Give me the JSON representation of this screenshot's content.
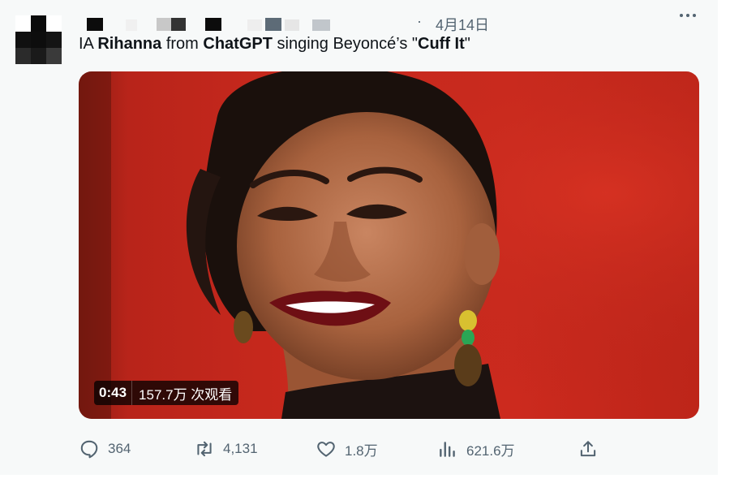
{
  "tweet": {
    "date_separator": "·",
    "date": "4月14日",
    "text": {
      "part1": "IA ",
      "bold1": "Rihanna",
      "part2": " from ",
      "bold2": "ChatGPT",
      "part3": " singing Beyoncé’s \"",
      "bold3": "Cuff It",
      "part4": "\""
    },
    "media": {
      "duration": "0:43",
      "views": "157.7万 次观看"
    },
    "actions": {
      "reply": {
        "icon": "reply-icon",
        "count": "364"
      },
      "retweet": {
        "icon": "retweet-icon",
        "count": "4,131"
      },
      "like": {
        "icon": "heart-icon",
        "count": "1.8万"
      },
      "views": {
        "icon": "analytics-icon",
        "count": "621.6万"
      },
      "share": {
        "icon": "share-icon"
      }
    }
  },
  "colors": {
    "background": "#f7f9f9",
    "text": "#0f1419",
    "muted": "#536471",
    "media_red": "#c9291d"
  }
}
